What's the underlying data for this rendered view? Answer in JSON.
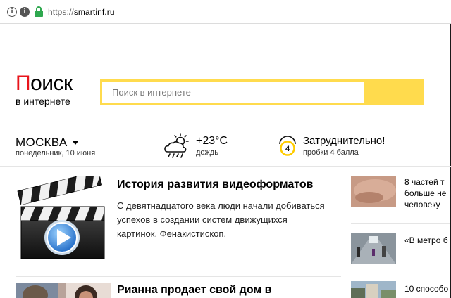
{
  "browser": {
    "url_scheme": "https://",
    "url_host": "smartinf.ru"
  },
  "logo": {
    "first_letter": "П",
    "rest": "оиск",
    "subtitle": "в интернете"
  },
  "search": {
    "placeholder": "Поиск в интернете"
  },
  "info": {
    "city": "МОСКВА",
    "date": "понедельник, 10 июня",
    "temperature": "+23°C",
    "weather": "дождь",
    "traffic_title": "Затруднительно!",
    "traffic_desc": "пробки 4 балла",
    "traffic_score": "4"
  },
  "news": [
    {
      "title": "История развития видеоформатов",
      "text": "С девятнадцатого века люди начали добиваться успехов в создании систем движущихся картинок. Фенакистископ,",
      "icon": "video-clapperboard-icon"
    },
    {
      "title": "Рианна продает свой дом в"
    }
  ],
  "side_news": [
    {
      "lines": [
        "8 частей т",
        "больше не",
        "человеку"
      ]
    },
    {
      "lines": [
        "«В метро б"
      ]
    },
    {
      "lines": [
        "10 способо"
      ]
    }
  ],
  "colors": {
    "brand_red": "#e8141b",
    "search_yellow": "#ffdb4d",
    "lock_green": "#2fa84f"
  }
}
